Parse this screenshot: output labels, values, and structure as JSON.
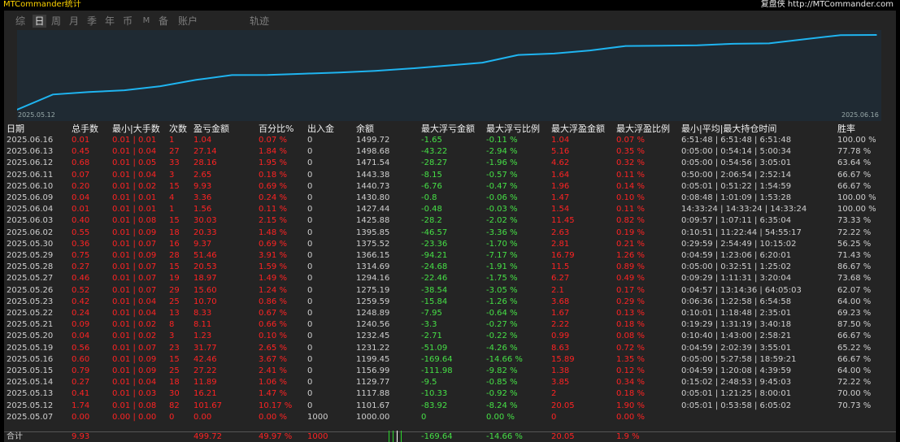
{
  "app": {
    "title": "MTCommander统计",
    "copyright": "复盘侠 http://MTCommander.com"
  },
  "tabs": [
    {
      "label": "综",
      "active": false
    },
    {
      "label": "日",
      "active": true
    },
    {
      "label": "周",
      "active": false
    },
    {
      "label": "月",
      "active": false
    },
    {
      "label": "季",
      "active": false
    },
    {
      "label": "年",
      "active": false
    },
    {
      "label": "币",
      "active": false
    },
    {
      "label": "M",
      "active": false
    },
    {
      "label": "备",
      "active": false
    },
    {
      "label": "账户",
      "active": false
    },
    {
      "label": "轨迹",
      "active": false
    }
  ],
  "chart_data": {
    "type": "line",
    "x_start_label": "2025.05.12",
    "x_end_label": "2025.06.16",
    "x": [
      "2025.05.07",
      "2025.05.12",
      "2025.05.13",
      "2025.05.14",
      "2025.05.15",
      "2025.05.16",
      "2025.05.19",
      "2025.05.20",
      "2025.05.21",
      "2025.05.22",
      "2025.05.23",
      "2025.05.26",
      "2025.05.27",
      "2025.05.28",
      "2025.05.29",
      "2025.05.30",
      "2025.06.02",
      "2025.06.03",
      "2025.06.04",
      "2025.06.09",
      "2025.06.10",
      "2025.06.11",
      "2025.06.12",
      "2025.06.13",
      "2025.06.16"
    ],
    "values": [
      1000.0,
      1101.67,
      1117.88,
      1129.77,
      1156.99,
      1199.45,
      1231.22,
      1232.45,
      1240.56,
      1248.89,
      1259.59,
      1275.19,
      1294.16,
      1314.69,
      1366.15,
      1375.52,
      1395.85,
      1425.88,
      1427.44,
      1430.8,
      1440.73,
      1443.38,
      1471.54,
      1498.68,
      1499.72
    ],
    "color": "#1fb4f0"
  },
  "table": {
    "headers": [
      "日期",
      "总手数",
      "最小|大手数",
      "次数",
      "盈亏金额",
      "百分比%",
      "出入金",
      "余额",
      "最大浮亏金额",
      "最大浮亏比例",
      "最大浮盈金额",
      "最大浮盈比例",
      "最小|平均|最大持仓时间",
      "胜率"
    ],
    "rows": [
      [
        "2025.06.16",
        "0.01",
        "0.01 | 0.01",
        "1",
        "1.04",
        "0.07 %",
        "0",
        "1499.72",
        "-1.65",
        "-0.11 %",
        "1.04",
        "0.07 %",
        "6:51:48 | 6:51:48 | 6:51:48",
        "100.00 %"
      ],
      [
        "2025.06.13",
        "0.45",
        "0.01 | 0.04",
        "27",
        "27.14",
        "1.84 %",
        "0",
        "1498.68",
        "-43.22",
        "-2.94 %",
        "5.16",
        "0.35 %",
        "0:05:00 | 0:54:14 | 5:00:34",
        "77.78 %"
      ],
      [
        "2025.06.12",
        "0.68",
        "0.01 | 0.05",
        "33",
        "28.16",
        "1.95 %",
        "0",
        "1471.54",
        "-28.27",
        "-1.96 %",
        "4.62",
        "0.32 %",
        "0:05:00 | 0:54:56 | 3:05:01",
        "63.64 %"
      ],
      [
        "2025.06.11",
        "0.07",
        "0.01 | 0.04",
        "3",
        "2.65",
        "0.18 %",
        "0",
        "1443.38",
        "-8.15",
        "-0.57 %",
        "1.64",
        "0.11 %",
        "0:50:00 | 2:06:54 | 2:52:14",
        "66.67 %"
      ],
      [
        "2025.06.10",
        "0.20",
        "0.01 | 0.02",
        "15",
        "9.93",
        "0.69 %",
        "0",
        "1440.73",
        "-6.76",
        "-0.47 %",
        "1.96",
        "0.14 %",
        "0:05:01 | 0:51:22 | 1:54:59",
        "66.67 %"
      ],
      [
        "2025.06.09",
        "0.04",
        "0.01 | 0.01",
        "4",
        "3.36",
        "0.24 %",
        "0",
        "1430.80",
        "-0.8",
        "-0.06 %",
        "1.47",
        "0.10 %",
        "0:08:48 | 1:01:09 | 1:53:28",
        "100.00 %"
      ],
      [
        "2025.06.04",
        "0.01",
        "0.01 | 0.01",
        "1",
        "1.56",
        "0.11 %",
        "0",
        "1427.44",
        "-0.48",
        "-0.03 %",
        "1.54",
        "0.11 %",
        "14:33:24 | 14:33:24 | 14:33:24",
        "100.00 %"
      ],
      [
        "2025.06.03",
        "0.40",
        "0.01 | 0.08",
        "15",
        "30.03",
        "2.15 %",
        "0",
        "1425.88",
        "-28.2",
        "-2.02 %",
        "11.45",
        "0.82 %",
        "0:09:57 | 1:07:11 | 6:35:04",
        "73.33 %"
      ],
      [
        "2025.06.02",
        "0.55",
        "0.01 | 0.09",
        "18",
        "20.33",
        "1.48 %",
        "0",
        "1395.85",
        "-46.57",
        "-3.36 %",
        "2.63",
        "0.19 %",
        "0:10:51 | 11:22:44 | 54:55:17",
        "72.22 %"
      ],
      [
        "2025.05.30",
        "0.36",
        "0.01 | 0.07",
        "16",
        "9.37",
        "0.69 %",
        "0",
        "1375.52",
        "-23.36",
        "-1.70 %",
        "2.81",
        "0.21 %",
        "0:29:59 | 2:54:49 | 10:15:02",
        "56.25 %"
      ],
      [
        "2025.05.29",
        "0.75",
        "0.01 | 0.09",
        "28",
        "51.46",
        "3.91 %",
        "0",
        "1366.15",
        "-94.21",
        "-7.17 %",
        "16.79",
        "1.26 %",
        "0:04:59 | 1:23:06 | 6:20:01",
        "71.43 %"
      ],
      [
        "2025.05.28",
        "0.27",
        "0.01 | 0.07",
        "15",
        "20.53",
        "1.59 %",
        "0",
        "1314.69",
        "-24.68",
        "-1.91 %",
        "11.5",
        "0.89 %",
        "0:05:00 | 0:32:51 | 1:25:02",
        "86.67 %"
      ],
      [
        "2025.05.27",
        "0.46",
        "0.01 | 0.07",
        "19",
        "18.97",
        "1.49 %",
        "0",
        "1294.16",
        "-22.46",
        "-1.75 %",
        "6.27",
        "0.49 %",
        "0:09:29 | 1:11:31 | 3:20:04",
        "73.68 %"
      ],
      [
        "2025.05.26",
        "0.52",
        "0.01 | 0.07",
        "29",
        "15.60",
        "1.24 %",
        "0",
        "1275.19",
        "-38.54",
        "-3.05 %",
        "2.1",
        "0.17 %",
        "0:04:57 | 13:14:36 | 64:05:03",
        "62.07 %"
      ],
      [
        "2025.05.23",
        "0.42",
        "0.01 | 0.04",
        "25",
        "10.70",
        "0.86 %",
        "0",
        "1259.59",
        "-15.84",
        "-1.26 %",
        "3.68",
        "0.29 %",
        "0:06:36 | 1:22:58 | 6:54:58",
        "64.00 %"
      ],
      [
        "2025.05.22",
        "0.24",
        "0.01 | 0.04",
        "13",
        "8.33",
        "0.67 %",
        "0",
        "1248.89",
        "-7.95",
        "-0.64 %",
        "1.67",
        "0.13 %",
        "0:10:01 | 1:18:48 | 2:35:01",
        "69.23 %"
      ],
      [
        "2025.05.21",
        "0.09",
        "0.01 | 0.02",
        "8",
        "8.11",
        "0.66 %",
        "0",
        "1240.56",
        "-3.3",
        "-0.27 %",
        "2.22",
        "0.18 %",
        "0:19:29 | 1:31:19 | 3:40:18",
        "87.50 %"
      ],
      [
        "2025.05.20",
        "0.04",
        "0.01 | 0.02",
        "3",
        "1.23",
        "0.10 %",
        "0",
        "1232.45",
        "-2.71",
        "-0.22 %",
        "0.99",
        "0.08 %",
        "0:10:40 | 1:43:00 | 2:58:21",
        "66.67 %"
      ],
      [
        "2025.05.19",
        "0.56",
        "0.01 | 0.07",
        "23",
        "31.77",
        "2.65 %",
        "0",
        "1231.22",
        "-51.09",
        "-4.26 %",
        "8.63",
        "0.72 %",
        "0:04:59 | 2:02:39 | 3:55:01",
        "65.22 %"
      ],
      [
        "2025.05.16",
        "0.60",
        "0.01 | 0.09",
        "15",
        "42.46",
        "3.67 %",
        "0",
        "1199.45",
        "-169.64",
        "-14.66 %",
        "15.89",
        "1.35 %",
        "0:05:00 | 5:27:58 | 18:59:21",
        "66.67 %"
      ],
      [
        "2025.05.15",
        "0.79",
        "0.01 | 0.09",
        "25",
        "27.22",
        "2.41 %",
        "0",
        "1156.99",
        "-111.98",
        "-9.82 %",
        "1.38",
        "0.12 %",
        "0:04:59 | 1:20:08 | 4:39:59",
        "64.00 %"
      ],
      [
        "2025.05.14",
        "0.27",
        "0.01 | 0.04",
        "18",
        "11.89",
        "1.06 %",
        "0",
        "1129.77",
        "-9.5",
        "-0.85 %",
        "3.85",
        "0.34 %",
        "0:15:02 | 2:48:53 | 9:45:03",
        "72.22 %"
      ],
      [
        "2025.05.13",
        "0.41",
        "0.01 | 0.03",
        "30",
        "16.21",
        "1.47 %",
        "0",
        "1117.88",
        "-10.33",
        "-0.92 %",
        "2",
        "0.18 %",
        "0:05:01 | 1:21:25 | 8:00:01",
        "70.00 %"
      ],
      [
        "2025.05.12",
        "1.74",
        "0.01 | 0.08",
        "82",
        "101.67",
        "10.17 %",
        "0",
        "1101.67",
        "-83.92",
        "-8.24 %",
        "20.05",
        "1.90 %",
        "0:05:01 | 0:53:58 | 6:05:02",
        "70.73 %"
      ],
      [
        "2025.05.07",
        "0.00",
        "0.00 | 0.00",
        "0",
        "0.00",
        "0.00 %",
        "1000",
        "1000.00",
        "0",
        "0.00 %",
        "0",
        "0.00 %",
        "",
        ""
      ]
    ],
    "footer": [
      "合计",
      "9.93",
      "",
      "",
      "499.72",
      "49.97 %",
      "1000",
      "",
      "-169.64",
      "-14.66 %",
      "20.05",
      "1.9 %",
      "",
      ""
    ]
  },
  "colors": {
    "profit": "#ff2323",
    "loss": "#46e046",
    "neutral": "#cfcfcf",
    "title": "#ffd400",
    "curve": "#1fb4f0"
  }
}
